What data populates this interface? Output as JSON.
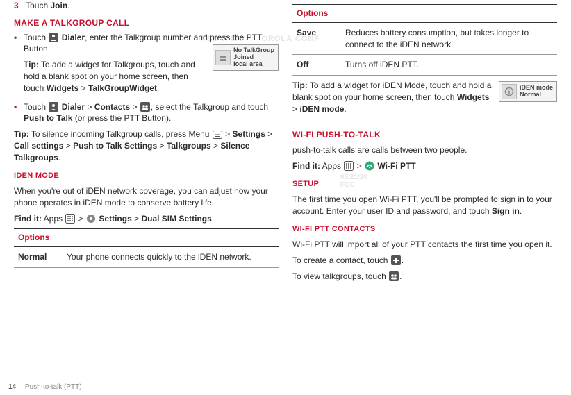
{
  "left": {
    "step3": {
      "num": "3",
      "text_before": "Touch",
      "join": "Join",
      "text_after": "."
    },
    "h_talkgroup": "Make a Talkgroup call",
    "bullet1_a": "Touch",
    "bullet1_dialer": "Dialer",
    "bullet1_b": ", enter the Talkgroup number and press the PTT Button.",
    "tip1_label": "Tip:",
    "tip1_a": "To add a widget for Talkgroups, touch and hold a blank spot on your home screen, then touch",
    "tip1_w": "Widgets",
    "tip1_gt": ">",
    "tip1_tg": "TalkGroupWidget",
    "tip1_dot": ".",
    "widget1": {
      "l1": "No TalkGroup",
      "l2": "Joined",
      "l3": "local area"
    },
    "bullet2_a": "Touch",
    "bullet2_dialer": "Dialer",
    "bullet2_gt1": ">",
    "bullet2_contacts": "Contacts",
    "bullet2_gt2": ">",
    "bullet2_b": ", select the Talkgroup and touch",
    "bullet2_ptt": "Push to Talk",
    "bullet2_c": "(or press the PTT Button).",
    "tip2_label": "Tip:",
    "tip2_a": "To silence incoming Talkgroup calls, press Menu",
    "tip2_gt1": ">",
    "tip2_settings": "Settings",
    "tip2_gt2": ">",
    "tip2_cs": "Call settings",
    "tip2_gt3": ">",
    "tip2_pts": "Push to Talk Settings",
    "tip2_gt4": ">",
    "tip2_tg": "Talkgroups",
    "tip2_gt5": ">",
    "tip2_st": "Silence Talkgroups",
    "tip2_dot": ".",
    "h_iden": "iDEN Mode",
    "iden_para": "When you're out of iDEN network coverage, you can adjust how your phone operates in iDEN mode to conserve battery life.",
    "findit_label": "Find it:",
    "findit_apps": "Apps",
    "findit_gt1": ">",
    "findit_settings": "Settings",
    "findit_gt2": ">",
    "findit_dss": "Dual SIM Settings",
    "table_header": "Options",
    "row_normal_key": "Normal",
    "row_normal_val": "Your phone connects quickly to the iDEN network."
  },
  "right": {
    "table_header": "Options",
    "row_save_key": "Save",
    "row_save_val": "Reduces battery consumption, but takes longer to connect to the iDEN network.",
    "row_off_key": "Off",
    "row_off_val": "Turns off iDEN PTT.",
    "tip_label": "Tip:",
    "tip_a": "To add a widget for iDEN Mode, touch and hold a blank spot on your home screen, then touch",
    "tip_w": "Widgets",
    "tip_gt": ">",
    "tip_im": "iDEN mode",
    "tip_dot": ".",
    "widget2": {
      "l1": "iDEN mode",
      "l2": "Normal"
    },
    "h_wifi": "Wi-Fi Push-to-talk",
    "wifi_para": "push-to-talk calls are calls between two people.",
    "findit_label": "Find it:",
    "findit_apps": "Apps",
    "findit_gt1": ">",
    "findit_wptt": "Wi-Fi PTT",
    "h_setup": "Setup",
    "setup_para_a": "The first time you open Wi-Fi PTT, you'll be prompted to sign in to your account. Enter your user ID and password, and touch",
    "setup_signin": "Sign in",
    "setup_dot": ".",
    "h_contacts": "Wi-Fi PTT contacts",
    "contacts_para": "Wi-Fi PTT will import all of your PTT contacts the first time you open it.",
    "create_a": "To create a contact, touch",
    "create_dot": ".",
    "view_a": "To view talkgroups, touch",
    "view_dot": "."
  },
  "footer": {
    "page": "14",
    "section": "Push-to-talk (PTT)"
  },
  "bg_date": "05/21/20",
  "bg_fcc": "FCC"
}
